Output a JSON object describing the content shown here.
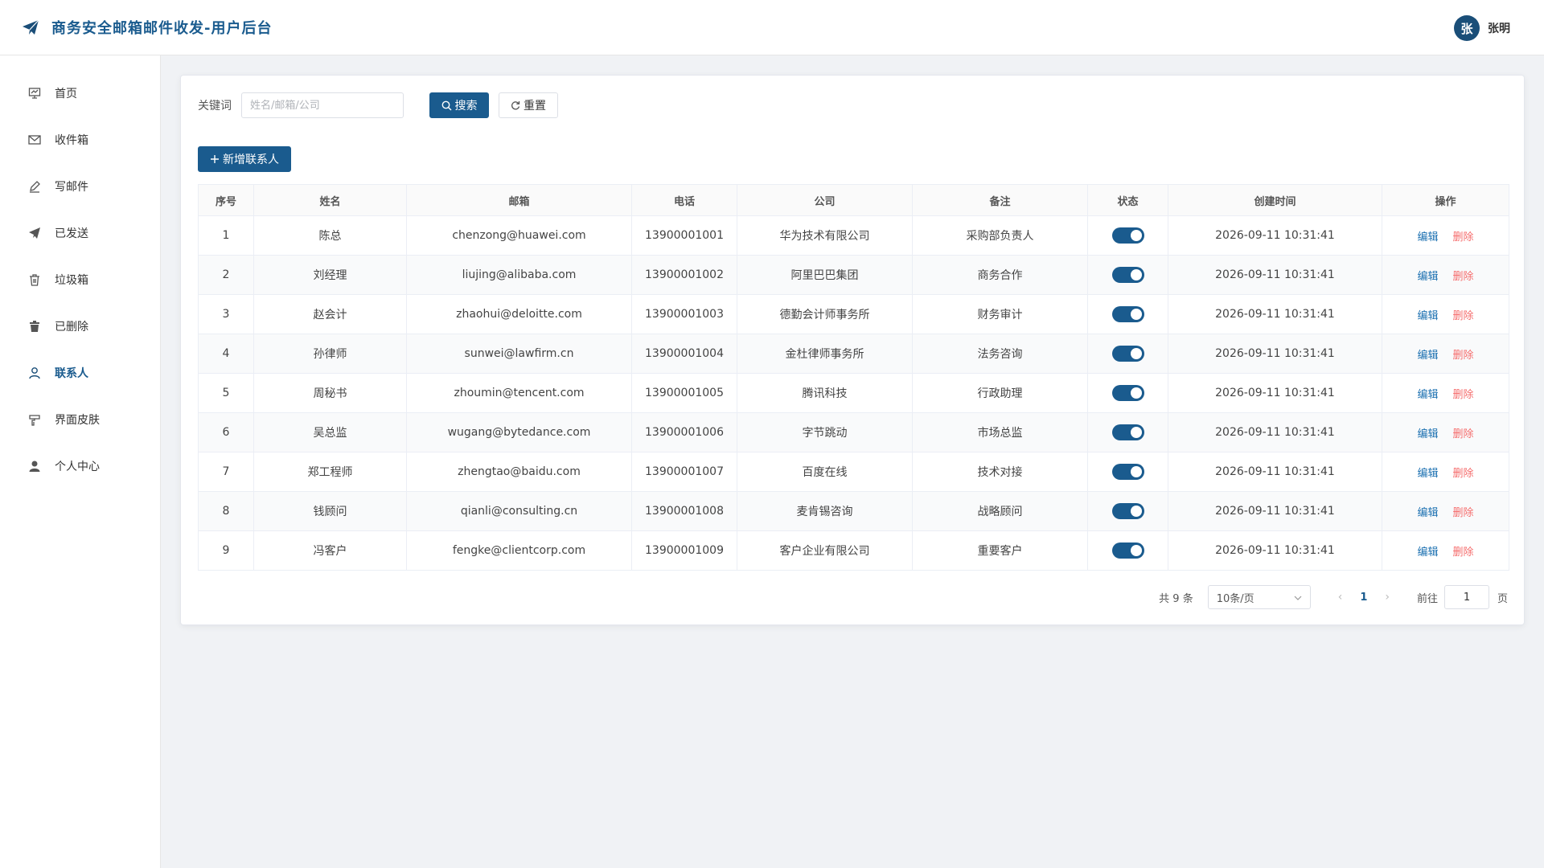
{
  "header": {
    "app_title": "商务安全邮箱邮件收发-用户后台",
    "logo_icon": "paper-plane-icon",
    "user": {
      "avatar_text": "张",
      "name": "张明"
    }
  },
  "sidebar": {
    "items": [
      {
        "label": "首页",
        "icon": "presentation-icon",
        "active": false
      },
      {
        "label": "收件箱",
        "icon": "mail-icon",
        "active": false
      },
      {
        "label": "写邮件",
        "icon": "pen-icon",
        "active": false
      },
      {
        "label": "已发送",
        "icon": "paper-plane-icon",
        "active": false
      },
      {
        "label": "垃圾箱",
        "icon": "trash-outline-icon",
        "active": false
      },
      {
        "label": "已删除",
        "icon": "trash-filled-icon",
        "active": false
      },
      {
        "label": "联系人",
        "icon": "user-outline-icon",
        "active": true
      },
      {
        "label": "界面皮肤",
        "icon": "palette-icon",
        "active": false
      },
      {
        "label": "个人中心",
        "icon": "user-filled-icon",
        "active": false
      }
    ]
  },
  "search": {
    "label": "关键词",
    "placeholder": "姓名/邮箱/公司",
    "value": "",
    "search_button": "搜索",
    "reset_button": "重置"
  },
  "toolbar": {
    "add_button": "新增联系人"
  },
  "table": {
    "columns": [
      "序号",
      "姓名",
      "邮箱",
      "电话",
      "公司",
      "备注",
      "状态",
      "创建时间",
      "操作"
    ],
    "edit_label": "编辑",
    "delete_label": "删除",
    "rows": [
      {
        "no": "1",
        "name": "陈总",
        "email": "chenzong@huawei.com",
        "phone": "13900001001",
        "company": "华为技术有限公司",
        "note": "采购部负责人",
        "enabled": true,
        "created": "2026-09-11 10:31:41"
      },
      {
        "no": "2",
        "name": "刘经理",
        "email": "liujing@alibaba.com",
        "phone": "13900001002",
        "company": "阿里巴巴集团",
        "note": "商务合作",
        "enabled": true,
        "created": "2026-09-11 10:31:41"
      },
      {
        "no": "3",
        "name": "赵会计",
        "email": "zhaohui@deloitte.com",
        "phone": "13900001003",
        "company": "德勤会计师事务所",
        "note": "财务审计",
        "enabled": true,
        "created": "2026-09-11 10:31:41"
      },
      {
        "no": "4",
        "name": "孙律师",
        "email": "sunwei@lawfirm.cn",
        "phone": "13900001004",
        "company": "金杜律师事务所",
        "note": "法务咨询",
        "enabled": true,
        "created": "2026-09-11 10:31:41"
      },
      {
        "no": "5",
        "name": "周秘书",
        "email": "zhoumin@tencent.com",
        "phone": "13900001005",
        "company": "腾讯科技",
        "note": "行政助理",
        "enabled": true,
        "created": "2026-09-11 10:31:41"
      },
      {
        "no": "6",
        "name": "吴总监",
        "email": "wugang@bytedance.com",
        "phone": "13900001006",
        "company": "字节跳动",
        "note": "市场总监",
        "enabled": true,
        "created": "2026-09-11 10:31:41"
      },
      {
        "no": "7",
        "name": "郑工程师",
        "email": "zhengtao@baidu.com",
        "phone": "13900001007",
        "company": "百度在线",
        "note": "技术对接",
        "enabled": true,
        "created": "2026-09-11 10:31:41"
      },
      {
        "no": "8",
        "name": "钱顾问",
        "email": "qianli@consulting.cn",
        "phone": "13900001008",
        "company": "麦肯锡咨询",
        "note": "战略顾问",
        "enabled": true,
        "created": "2026-09-11 10:31:41"
      },
      {
        "no": "9",
        "name": "冯客户",
        "email": "fengke@clientcorp.com",
        "phone": "13900001009",
        "company": "客户企业有限公司",
        "note": "重要客户",
        "enabled": true,
        "created": "2026-09-11 10:31:41"
      }
    ]
  },
  "pagination": {
    "total_text": "共 9 条",
    "page_size": "10条/页",
    "current_page": "1",
    "goto_label": "前往",
    "jump_value": "1",
    "page_unit": "页"
  },
  "colors": {
    "primary": "#1a5b8e",
    "danger": "#f56c6c",
    "link": "#1a6fb0"
  }
}
